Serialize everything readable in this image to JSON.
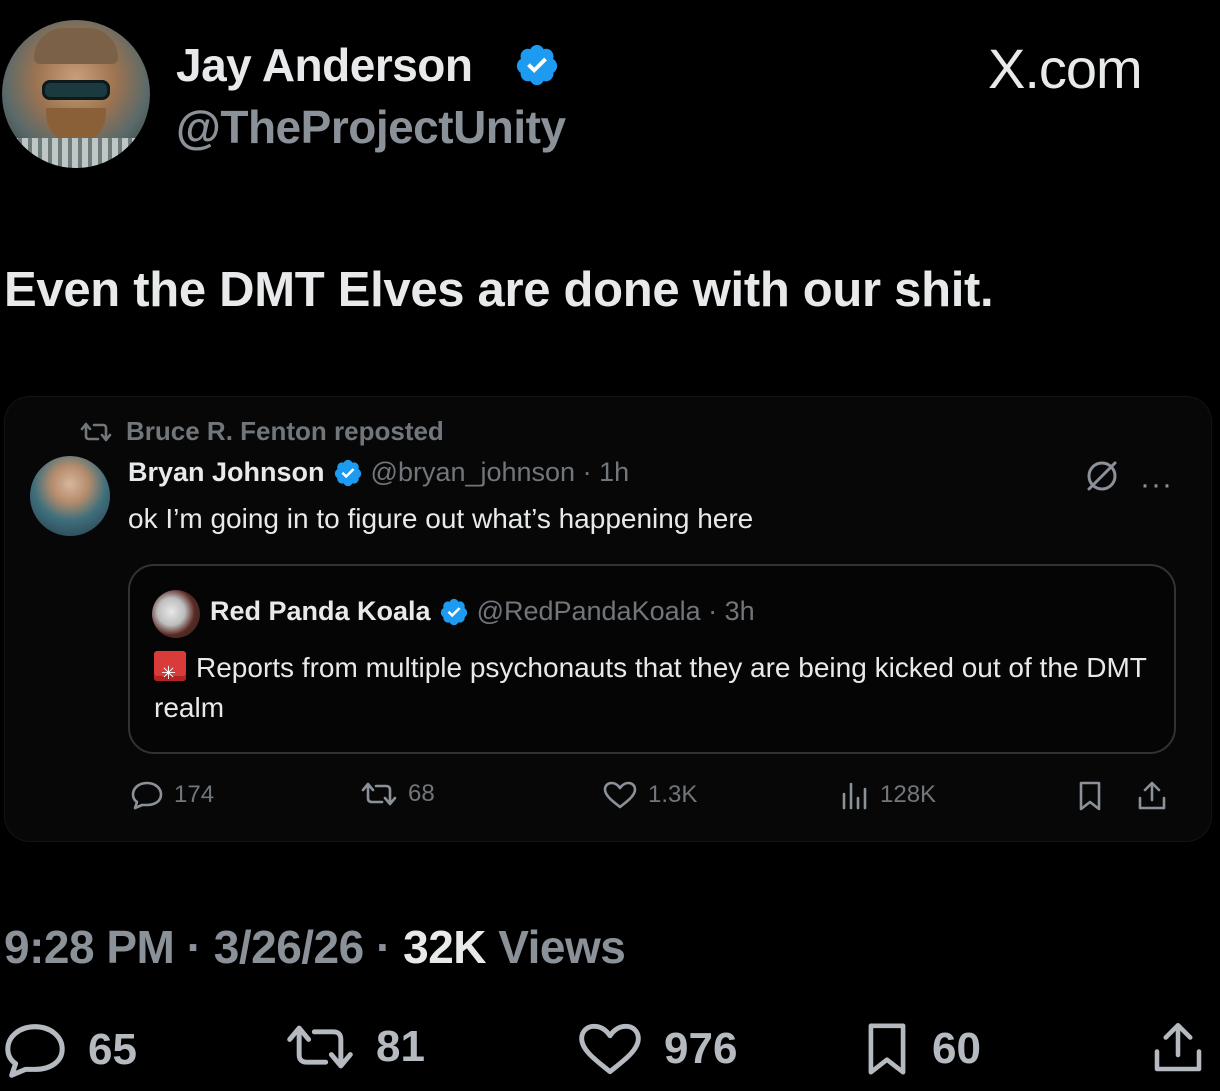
{
  "author": {
    "name": "Jay Anderson",
    "handle": "@TheProjectUnity"
  },
  "brand": "X.com",
  "tweet_text": "Even the DMT Elves are done with our shit.",
  "embedded": {
    "repost_label": "Bruce R. Fenton reposted",
    "author_name": "Bryan Johnson",
    "author_handle_time": "@bryan_johnson · 1h",
    "text": "ok I’m going in to figure out what’s happening here",
    "more_label": "···",
    "quote": {
      "author_name": "Red Panda Koala",
      "author_handle_time": "@RedPandaKoala · 3h",
      "text": "Reports from multiple psychonauts that they are being kicked out of the DMT realm"
    },
    "stats": {
      "replies": "174",
      "reposts": "68",
      "likes": "1.3K",
      "views": "128K"
    }
  },
  "meta": {
    "time": "9:28 PM",
    "sep1": " · ",
    "date": "3/26/26",
    "sep2": " · ",
    "views_count": "32K",
    "views_label": " Views"
  },
  "stats": {
    "replies": "65",
    "reposts": "81",
    "likes": "976",
    "bookmarks": "60"
  },
  "colors": {
    "verified": "#1d9bf0",
    "text": "#e7e9ea",
    "muted": "#71767b",
    "background": "#000000"
  }
}
